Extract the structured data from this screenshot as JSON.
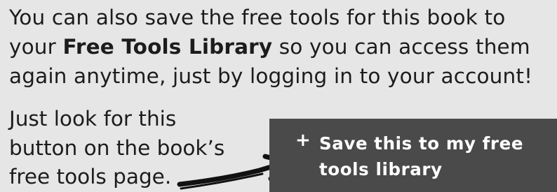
{
  "paragraph": {
    "line1": "You can also save the free tools for this book to",
    "line2_prefix": "your ",
    "line2_bold": "Free Tools Library",
    "line2_suffix": " so you can access them",
    "line3": "again anytime, just by logging in to your account!"
  },
  "instruction": {
    "line1": "Just look for this",
    "line2": "button on the book’s",
    "line3": "free tools page."
  },
  "save_button": {
    "icon": "plus-icon",
    "icon_glyph": "+",
    "label": "Save this to my free tools library",
    "background": "#4a4a4a",
    "text_color": "#ffffff"
  },
  "colors": {
    "page_background": "#e6e6e6",
    "text": "#1c1c1c",
    "arrow": "#111111"
  }
}
